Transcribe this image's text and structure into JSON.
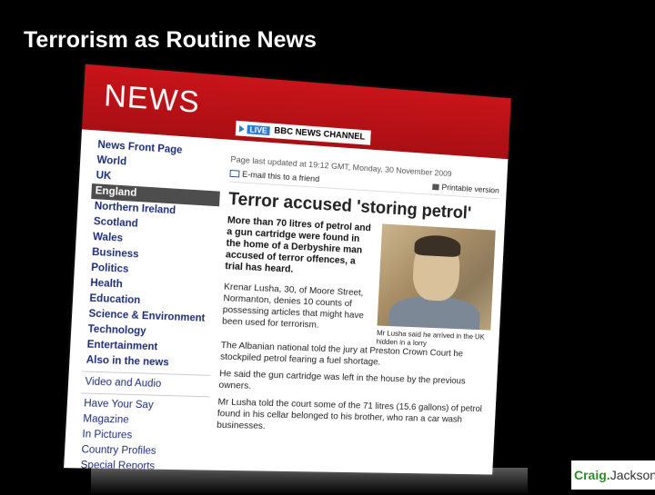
{
  "slide": {
    "title": "Terrorism as Routine News"
  },
  "bbc": {
    "banner_title": "NEWS",
    "live_label": "LIVE",
    "channel_label": "BBC NEWS CHANNEL",
    "nav": [
      {
        "label": "News Front Page",
        "active": false
      },
      {
        "label": "World",
        "active": false
      },
      {
        "label": "UK",
        "active": false
      },
      {
        "label": "England",
        "active": true
      },
      {
        "label": "Northern Ireland",
        "active": false
      },
      {
        "label": "Scotland",
        "active": false
      },
      {
        "label": "Wales",
        "active": false
      },
      {
        "label": "Business",
        "active": false
      },
      {
        "label": "Politics",
        "active": false
      },
      {
        "label": "Health",
        "active": false
      },
      {
        "label": "Education",
        "active": false
      },
      {
        "label": "Science & Environment",
        "active": false
      },
      {
        "label": "Technology",
        "active": false
      },
      {
        "label": "Entertainment",
        "active": false
      },
      {
        "label": "Also in the news",
        "active": false
      }
    ],
    "nav_secondary": [
      "Video and Audio"
    ],
    "nav_tertiary": [
      "Have Your Say",
      "Magazine",
      "In Pictures",
      "Country Profiles",
      "Special Reports"
    ],
    "updated": "Page last updated at 19:12 GMT, Monday, 30 November 2009",
    "email_label": "E-mail this to a friend",
    "print_label": "Printable version",
    "headline": "Terror accused 'storing petrol'",
    "lead": "More than 70 litres of petrol and a gun cartridge were found in the home of a Derbyshire man accused of terror offences, a trial has heard.",
    "para1": "Krenar Lusha, 30, of Moore Street, Normanton, denies 10 counts of possessing articles that might have been used for terrorism.",
    "caption": "Mr Lusha said he arrived in the UK hidden in a lorry",
    "para2": "The Albanian national told the jury at Preston Crown Court he stockpiled petrol fearing a fuel shortage.",
    "para3": "He said the gun cartridge was left in the house by the previous owners.",
    "para4": "Mr Lusha told the court some of the 71 litres (15.6 gallons) of petrol found in his cellar belonged to his brother, who ran a car wash businesses."
  },
  "logo": {
    "first": "Craig.",
    "second": "Jackson"
  },
  "colors": {
    "bbc_red": "#b5121b",
    "nav_blue": "#1e2e74",
    "active_bg": "#4d4d4d"
  }
}
